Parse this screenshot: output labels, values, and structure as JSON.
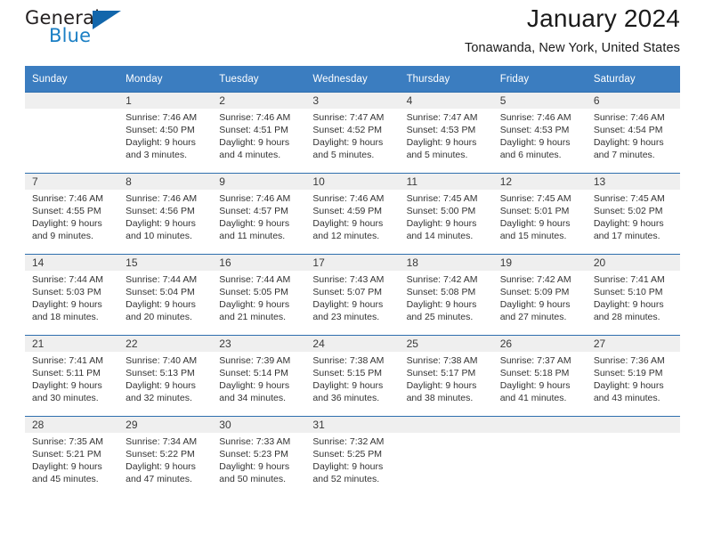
{
  "brand": {
    "name_top": "General",
    "name_bottom": "Blue",
    "triangle_color": "#1266ab",
    "blue_color": "#1b7fc4"
  },
  "header": {
    "title": "January 2024",
    "subtitle": "Tonawanda, New York, United States"
  },
  "theme": {
    "header_bg": "#3b7dc0",
    "row_divider": "#2f6fae",
    "daynum_band_bg": "#efefef"
  },
  "weekday_headers": [
    "Sunday",
    "Monday",
    "Tuesday",
    "Wednesday",
    "Thursday",
    "Friday",
    "Saturday"
  ],
  "weeks": [
    [
      {
        "day": "",
        "sunrise": "",
        "sunset": "",
        "daylight_line1": "",
        "daylight_line2": "",
        "empty": true
      },
      {
        "day": "1",
        "sunrise": "Sunrise: 7:46 AM",
        "sunset": "Sunset: 4:50 PM",
        "daylight_line1": "Daylight: 9 hours",
        "daylight_line2": "and 3 minutes."
      },
      {
        "day": "2",
        "sunrise": "Sunrise: 7:46 AM",
        "sunset": "Sunset: 4:51 PM",
        "daylight_line1": "Daylight: 9 hours",
        "daylight_line2": "and 4 minutes."
      },
      {
        "day": "3",
        "sunrise": "Sunrise: 7:47 AM",
        "sunset": "Sunset: 4:52 PM",
        "daylight_line1": "Daylight: 9 hours",
        "daylight_line2": "and 5 minutes."
      },
      {
        "day": "4",
        "sunrise": "Sunrise: 7:47 AM",
        "sunset": "Sunset: 4:53 PM",
        "daylight_line1": "Daylight: 9 hours",
        "daylight_line2": "and 5 minutes."
      },
      {
        "day": "5",
        "sunrise": "Sunrise: 7:46 AM",
        "sunset": "Sunset: 4:53 PM",
        "daylight_line1": "Daylight: 9 hours",
        "daylight_line2": "and 6 minutes."
      },
      {
        "day": "6",
        "sunrise": "Sunrise: 7:46 AM",
        "sunset": "Sunset: 4:54 PM",
        "daylight_line1": "Daylight: 9 hours",
        "daylight_line2": "and 7 minutes."
      }
    ],
    [
      {
        "day": "7",
        "sunrise": "Sunrise: 7:46 AM",
        "sunset": "Sunset: 4:55 PM",
        "daylight_line1": "Daylight: 9 hours",
        "daylight_line2": "and 9 minutes."
      },
      {
        "day": "8",
        "sunrise": "Sunrise: 7:46 AM",
        "sunset": "Sunset: 4:56 PM",
        "daylight_line1": "Daylight: 9 hours",
        "daylight_line2": "and 10 minutes."
      },
      {
        "day": "9",
        "sunrise": "Sunrise: 7:46 AM",
        "sunset": "Sunset: 4:57 PM",
        "daylight_line1": "Daylight: 9 hours",
        "daylight_line2": "and 11 minutes."
      },
      {
        "day": "10",
        "sunrise": "Sunrise: 7:46 AM",
        "sunset": "Sunset: 4:59 PM",
        "daylight_line1": "Daylight: 9 hours",
        "daylight_line2": "and 12 minutes."
      },
      {
        "day": "11",
        "sunrise": "Sunrise: 7:45 AM",
        "sunset": "Sunset: 5:00 PM",
        "daylight_line1": "Daylight: 9 hours",
        "daylight_line2": "and 14 minutes."
      },
      {
        "day": "12",
        "sunrise": "Sunrise: 7:45 AM",
        "sunset": "Sunset: 5:01 PM",
        "daylight_line1": "Daylight: 9 hours",
        "daylight_line2": "and 15 minutes."
      },
      {
        "day": "13",
        "sunrise": "Sunrise: 7:45 AM",
        "sunset": "Sunset: 5:02 PM",
        "daylight_line1": "Daylight: 9 hours",
        "daylight_line2": "and 17 minutes."
      }
    ],
    [
      {
        "day": "14",
        "sunrise": "Sunrise: 7:44 AM",
        "sunset": "Sunset: 5:03 PM",
        "daylight_line1": "Daylight: 9 hours",
        "daylight_line2": "and 18 minutes."
      },
      {
        "day": "15",
        "sunrise": "Sunrise: 7:44 AM",
        "sunset": "Sunset: 5:04 PM",
        "daylight_line1": "Daylight: 9 hours",
        "daylight_line2": "and 20 minutes."
      },
      {
        "day": "16",
        "sunrise": "Sunrise: 7:44 AM",
        "sunset": "Sunset: 5:05 PM",
        "daylight_line1": "Daylight: 9 hours",
        "daylight_line2": "and 21 minutes."
      },
      {
        "day": "17",
        "sunrise": "Sunrise: 7:43 AM",
        "sunset": "Sunset: 5:07 PM",
        "daylight_line1": "Daylight: 9 hours",
        "daylight_line2": "and 23 minutes."
      },
      {
        "day": "18",
        "sunrise": "Sunrise: 7:42 AM",
        "sunset": "Sunset: 5:08 PM",
        "daylight_line1": "Daylight: 9 hours",
        "daylight_line2": "and 25 minutes."
      },
      {
        "day": "19",
        "sunrise": "Sunrise: 7:42 AM",
        "sunset": "Sunset: 5:09 PM",
        "daylight_line1": "Daylight: 9 hours",
        "daylight_line2": "and 27 minutes."
      },
      {
        "day": "20",
        "sunrise": "Sunrise: 7:41 AM",
        "sunset": "Sunset: 5:10 PM",
        "daylight_line1": "Daylight: 9 hours",
        "daylight_line2": "and 28 minutes."
      }
    ],
    [
      {
        "day": "21",
        "sunrise": "Sunrise: 7:41 AM",
        "sunset": "Sunset: 5:11 PM",
        "daylight_line1": "Daylight: 9 hours",
        "daylight_line2": "and 30 minutes."
      },
      {
        "day": "22",
        "sunrise": "Sunrise: 7:40 AM",
        "sunset": "Sunset: 5:13 PM",
        "daylight_line1": "Daylight: 9 hours",
        "daylight_line2": "and 32 minutes."
      },
      {
        "day": "23",
        "sunrise": "Sunrise: 7:39 AM",
        "sunset": "Sunset: 5:14 PM",
        "daylight_line1": "Daylight: 9 hours",
        "daylight_line2": "and 34 minutes."
      },
      {
        "day": "24",
        "sunrise": "Sunrise: 7:38 AM",
        "sunset": "Sunset: 5:15 PM",
        "daylight_line1": "Daylight: 9 hours",
        "daylight_line2": "and 36 minutes."
      },
      {
        "day": "25",
        "sunrise": "Sunrise: 7:38 AM",
        "sunset": "Sunset: 5:17 PM",
        "daylight_line1": "Daylight: 9 hours",
        "daylight_line2": "and 38 minutes."
      },
      {
        "day": "26",
        "sunrise": "Sunrise: 7:37 AM",
        "sunset": "Sunset: 5:18 PM",
        "daylight_line1": "Daylight: 9 hours",
        "daylight_line2": "and 41 minutes."
      },
      {
        "day": "27",
        "sunrise": "Sunrise: 7:36 AM",
        "sunset": "Sunset: 5:19 PM",
        "daylight_line1": "Daylight: 9 hours",
        "daylight_line2": "and 43 minutes."
      }
    ],
    [
      {
        "day": "28",
        "sunrise": "Sunrise: 7:35 AM",
        "sunset": "Sunset: 5:21 PM",
        "daylight_line1": "Daylight: 9 hours",
        "daylight_line2": "and 45 minutes."
      },
      {
        "day": "29",
        "sunrise": "Sunrise: 7:34 AM",
        "sunset": "Sunset: 5:22 PM",
        "daylight_line1": "Daylight: 9 hours",
        "daylight_line2": "and 47 minutes."
      },
      {
        "day": "30",
        "sunrise": "Sunrise: 7:33 AM",
        "sunset": "Sunset: 5:23 PM",
        "daylight_line1": "Daylight: 9 hours",
        "daylight_line2": "and 50 minutes."
      },
      {
        "day": "31",
        "sunrise": "Sunrise: 7:32 AM",
        "sunset": "Sunset: 5:25 PM",
        "daylight_line1": "Daylight: 9 hours",
        "daylight_line2": "and 52 minutes."
      },
      {
        "day": "",
        "sunrise": "",
        "sunset": "",
        "daylight_line1": "",
        "daylight_line2": "",
        "empty": true
      },
      {
        "day": "",
        "sunrise": "",
        "sunset": "",
        "daylight_line1": "",
        "daylight_line2": "",
        "empty": true
      },
      {
        "day": "",
        "sunrise": "",
        "sunset": "",
        "daylight_line1": "",
        "daylight_line2": "",
        "empty": true
      }
    ]
  ]
}
